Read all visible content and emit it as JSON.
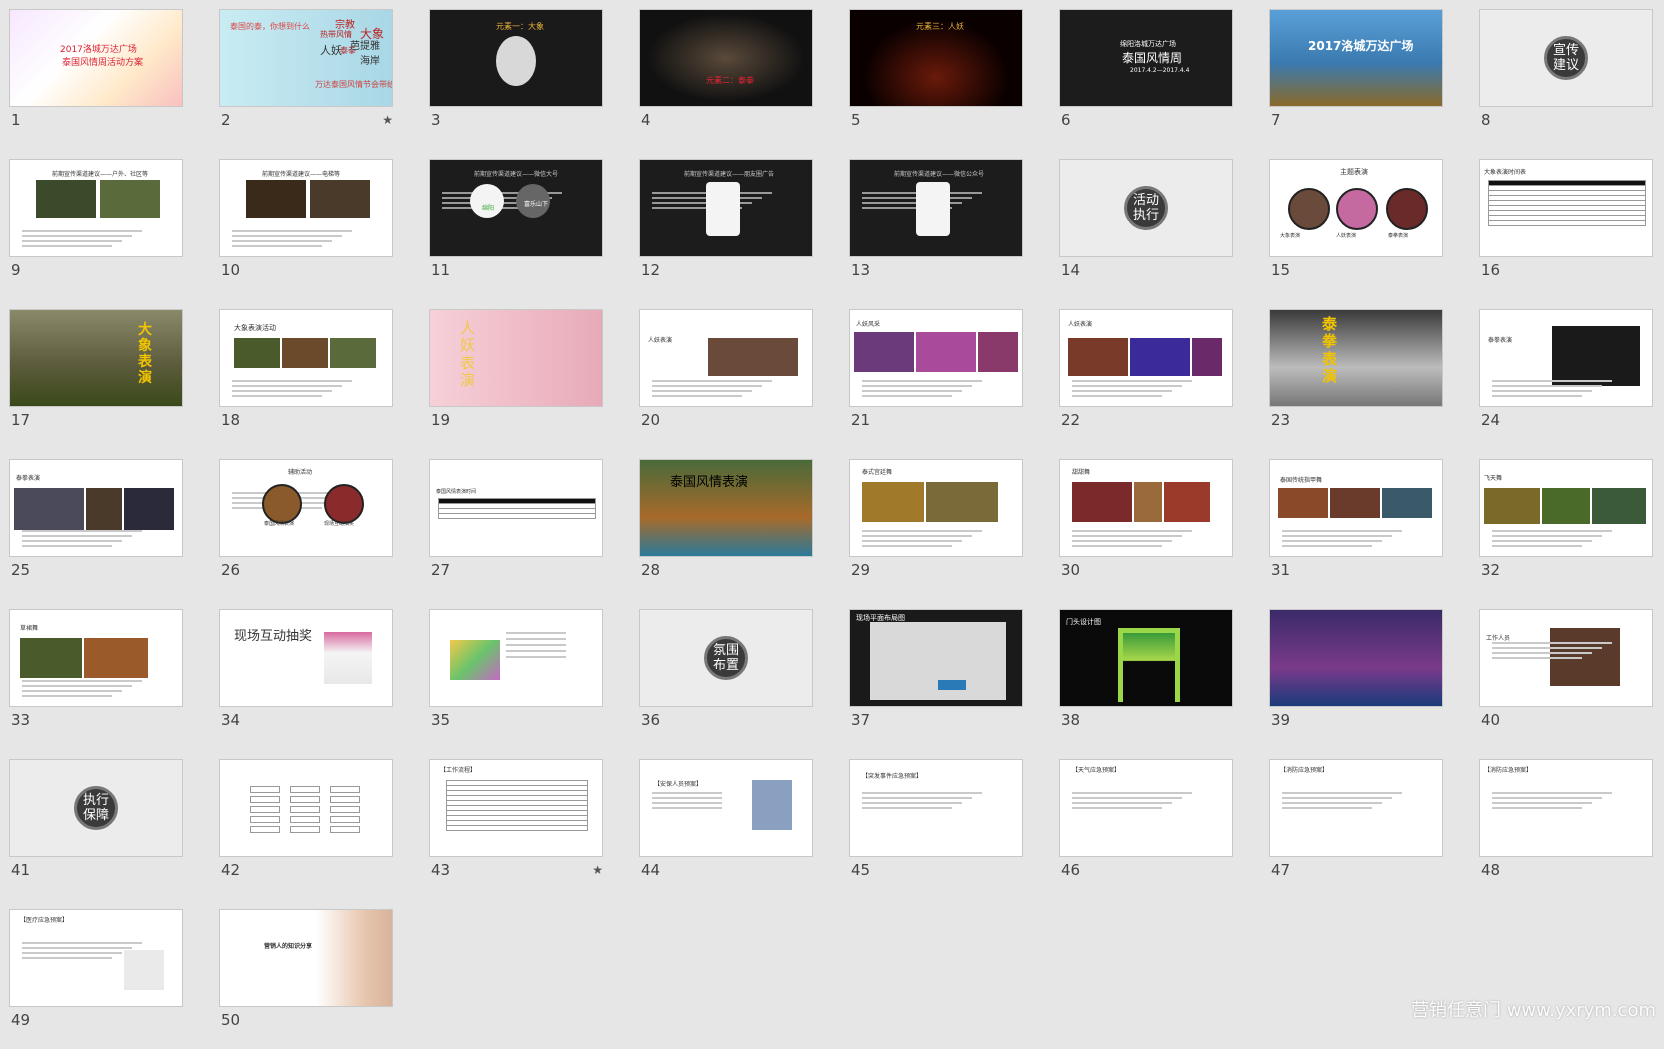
{
  "watermark": "营销任意门 www.yxrym.com",
  "slides": [
    {
      "n": "1",
      "bg": "#f4efe6",
      "texts": [
        "2017洛城万达广场",
        "泰国风情周活动方案"
      ]
    },
    {
      "n": "2",
      "bg": "#bfe3ec",
      "star": "★",
      "texts": [
        "泰国的泰，你想到什么",
        "宗教",
        "热带风情",
        "大象",
        "人妖",
        "泰拳",
        "芭提雅",
        "海岸",
        "万达泰国风情节会带给你什么？"
      ]
    },
    {
      "n": "3",
      "bg": "#1a1a1a",
      "texts": [
        "元素一：大象"
      ]
    },
    {
      "n": "4",
      "bg": "#111111",
      "texts": [
        "元素二：泰拳"
      ]
    },
    {
      "n": "5",
      "bg": "#0a0000",
      "texts": [
        "元素三：人妖"
      ]
    },
    {
      "n": "6",
      "bg": "#1c1c1c",
      "texts": [
        "绵阳洛城万达广场",
        "泰国风情周",
        "2017.4.2—2017.4.4"
      ]
    },
    {
      "n": "7",
      "bg": "#4a90c8",
      "texts": [
        "2017洛城万达广场"
      ]
    },
    {
      "n": "8",
      "bg": "#ececec",
      "texts": [
        "宣传建议"
      ]
    },
    {
      "n": "9",
      "bg": "#ffffff",
      "texts": [
        "前期宣传渠道建议——户外、社区等"
      ]
    },
    {
      "n": "10",
      "bg": "#ffffff",
      "texts": [
        "前期宣传渠道建议——电梯等"
      ]
    },
    {
      "n": "11",
      "bg": "#1c1c1c",
      "texts": [
        "前期宣传渠道建议——微信大号",
        "绵阳",
        "富乐山下"
      ]
    },
    {
      "n": "12",
      "bg": "#1c1c1c",
      "texts": [
        "前期宣传渠道建议——朋友圈广告"
      ]
    },
    {
      "n": "13",
      "bg": "#1c1c1c",
      "texts": [
        "前期宣传渠道建议——微信公众号"
      ]
    },
    {
      "n": "14",
      "bg": "#ececec",
      "texts": [
        "活动执行"
      ]
    },
    {
      "n": "15",
      "bg": "#ffffff",
      "texts": [
        "主题表演",
        "大象表演",
        "人妖表演",
        "泰拳表演"
      ]
    },
    {
      "n": "16",
      "bg": "#ffffff",
      "texts": [
        "大象表演时间表"
      ]
    },
    {
      "n": "17",
      "bg": "#6b6b4a",
      "texts": [
        "大象表演"
      ]
    },
    {
      "n": "18",
      "bg": "#ffffff",
      "texts": [
        "大象表演活动"
      ]
    },
    {
      "n": "19",
      "bg": "#f2c9d2",
      "texts": [
        "人妖表演"
      ]
    },
    {
      "n": "20",
      "bg": "#ffffff",
      "texts": [
        "人妖表演"
      ]
    },
    {
      "n": "21",
      "bg": "#ffffff",
      "texts": [
        "人妖风采"
      ]
    },
    {
      "n": "22",
      "bg": "#ffffff",
      "texts": [
        "人妖表演"
      ]
    },
    {
      "n": "23",
      "bg": "#8a8a8a",
      "texts": [
        "泰拳表演"
      ]
    },
    {
      "n": "24",
      "bg": "#ffffff",
      "texts": [
        "泰拳表演"
      ]
    },
    {
      "n": "25",
      "bg": "#ffffff",
      "texts": [
        "泰拳表演"
      ]
    },
    {
      "n": "26",
      "bg": "#ffffff",
      "texts": [
        "辅助活动",
        "泰国风情表演",
        "现场互动抽奖"
      ]
    },
    {
      "n": "27",
      "bg": "#ffffff",
      "texts": [
        "泰国风情表演时间"
      ]
    },
    {
      "n": "28",
      "bg": "#3a6a3a",
      "texts": [
        "泰国风情表演"
      ]
    },
    {
      "n": "29",
      "bg": "#ffffff",
      "texts": [
        "泰式宫廷舞"
      ]
    },
    {
      "n": "30",
      "bg": "#ffffff",
      "texts": [
        "甜甜舞"
      ]
    },
    {
      "n": "31",
      "bg": "#ffffff",
      "texts": [
        "泰国传统指甲舞"
      ]
    },
    {
      "n": "32",
      "bg": "#ffffff",
      "texts": [
        "飞天舞"
      ]
    },
    {
      "n": "33",
      "bg": "#ffffff",
      "texts": [
        "草裙舞"
      ]
    },
    {
      "n": "34",
      "bg": "#ffffff",
      "texts": [
        "现场互动抽奖"
      ]
    },
    {
      "n": "35",
      "bg": "#ffffff",
      "texts": []
    },
    {
      "n": "36",
      "bg": "#ececec",
      "texts": [
        "氛围布置"
      ]
    },
    {
      "n": "37",
      "bg": "#1a1a1a",
      "texts": [
        "现场平面布局图"
      ]
    },
    {
      "n": "38",
      "bg": "#0a0a0a",
      "texts": [
        "门头设计图"
      ]
    },
    {
      "n": "39",
      "bg": "#2a1a4a",
      "texts": []
    },
    {
      "n": "40",
      "bg": "#ffffff",
      "texts": [
        "工作人员"
      ]
    },
    {
      "n": "41",
      "bg": "#ececec",
      "texts": [
        "执行保障"
      ]
    },
    {
      "n": "42",
      "bg": "#ffffff",
      "texts": []
    },
    {
      "n": "43",
      "bg": "#ffffff",
      "star": "★",
      "texts": [
        "【工作流程】"
      ]
    },
    {
      "n": "44",
      "bg": "#ffffff",
      "texts": [
        "【安保人员预案】"
      ]
    },
    {
      "n": "45",
      "bg": "#ffffff",
      "texts": [
        "【突发事件应急预案】"
      ]
    },
    {
      "n": "46",
      "bg": "#ffffff",
      "texts": [
        "【天气应急预案】"
      ]
    },
    {
      "n": "47",
      "bg": "#ffffff",
      "texts": [
        "【消防应急预案】"
      ]
    },
    {
      "n": "48",
      "bg": "#ffffff",
      "texts": [
        "【消防应急预案】"
      ]
    },
    {
      "n": "49",
      "bg": "#ffffff",
      "texts": [
        "【医疗应急预案】"
      ]
    },
    {
      "n": "50",
      "bg": "#ffffff",
      "texts": [
        "营销人的知识分享"
      ]
    }
  ]
}
